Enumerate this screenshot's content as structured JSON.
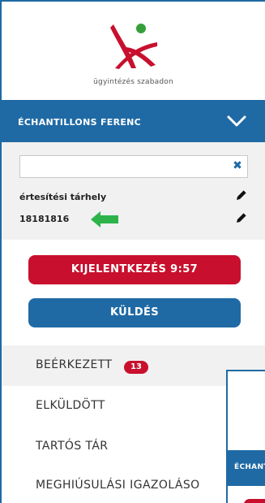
{
  "brand": {
    "tagline": "ügyintézés szabadon",
    "colors": {
      "primary": "#1f6aa5",
      "accent": "#c8102e",
      "logo_green": "#35a03b",
      "arrow_green": "#2db34a"
    }
  },
  "user": {
    "name": "ÉCHANTILLONS FERENC",
    "toggle_icon": "chevron-down-icon"
  },
  "storage": {
    "search_value": "",
    "clear_icon": "close-icon",
    "label": "értesítési tárhely",
    "id": "18181816",
    "edit_icon": "pencil-icon",
    "pointer_icon": "arrow-left-icon"
  },
  "actions": {
    "logout_label": "KIJELENTKEZÉS 9:57",
    "send_label": "KÜLDÉS"
  },
  "nav": {
    "items": [
      {
        "label": "BEÉRKEZETT",
        "badge": "13"
      },
      {
        "label": "ELKÜLDÖTT"
      },
      {
        "label": "TARTÓS TÁR"
      },
      {
        "label": "MEGHIÚSULÁSI IGAZOLÁSO"
      }
    ]
  },
  "overlay": {
    "user_name": "ÉCHANTILLONS FERENC"
  }
}
